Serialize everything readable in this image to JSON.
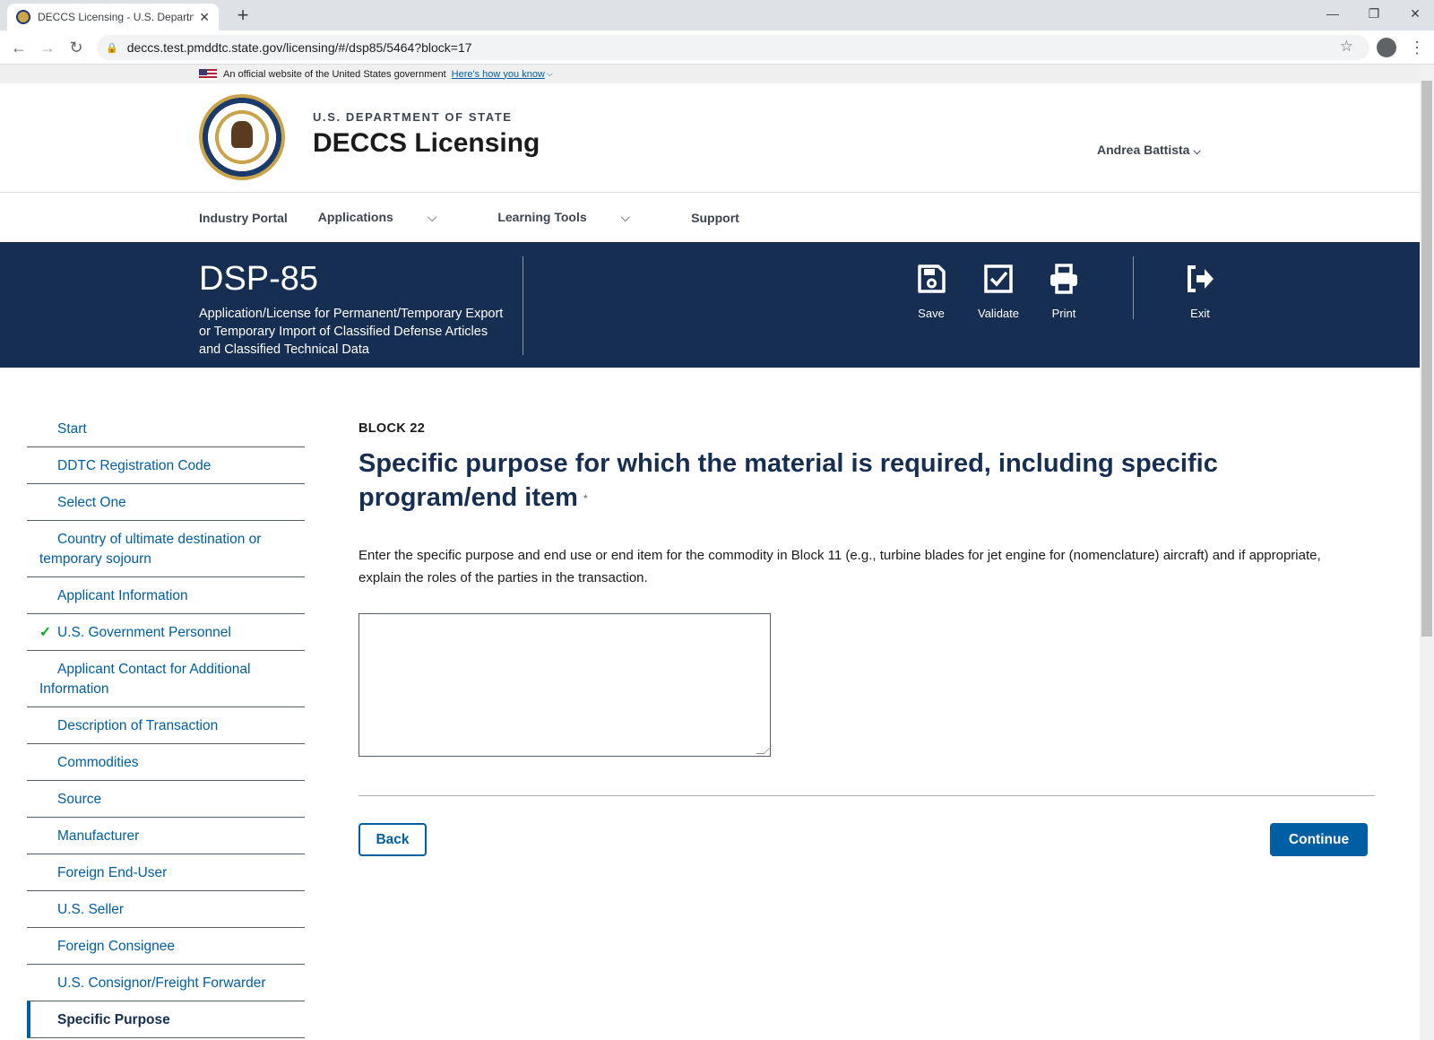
{
  "browser": {
    "tab_title": "DECCS Licensing - U.S. Departme",
    "url": "deccs.test.pmddtc.state.gov/licensing/#/dsp85/5464?block=17"
  },
  "gov_banner": {
    "text": "An official website of the United States government",
    "link": "Here's how you know"
  },
  "header": {
    "dept": "U.S. DEPARTMENT OF STATE",
    "site_title": "DECCS Licensing",
    "user": "Andrea Battista"
  },
  "nav": {
    "items": [
      "Industry Portal",
      "Applications",
      "Learning Tools",
      "Support"
    ]
  },
  "form_banner": {
    "form_number": "DSP-85",
    "description": "Application/License for Permanent/Temporary Export or Temporary Import of Classified Defense Articles and Classified Technical Data",
    "actions": [
      "Save",
      "Validate",
      "Print",
      "Exit"
    ]
  },
  "sidebar": {
    "items": [
      {
        "label": "Start",
        "state": "normal"
      },
      {
        "label": "DDTC Registration Code",
        "state": "normal"
      },
      {
        "label": "Select One",
        "state": "normal"
      },
      {
        "label": "Country of ultimate destination or temporary sojourn",
        "state": "normal"
      },
      {
        "label": "Applicant Information",
        "state": "normal"
      },
      {
        "label": "U.S. Government Personnel",
        "state": "complete"
      },
      {
        "label": "Applicant Contact for Additional Information",
        "state": "normal"
      },
      {
        "label": "Description of Transaction",
        "state": "normal"
      },
      {
        "label": "Commodities",
        "state": "normal"
      },
      {
        "label": "Source",
        "state": "normal"
      },
      {
        "label": "Manufacturer",
        "state": "normal"
      },
      {
        "label": "Foreign End-User",
        "state": "normal"
      },
      {
        "label": "U.S. Seller",
        "state": "normal"
      },
      {
        "label": "Foreign Consignee",
        "state": "normal"
      },
      {
        "label": "U.S. Consignor/Freight Forwarder",
        "state": "normal"
      },
      {
        "label": "Specific Purpose",
        "state": "active"
      }
    ]
  },
  "main": {
    "block": "BLOCK 22",
    "question": "Specific purpose for which the material is required, including specific program/end item",
    "required_mark": "*",
    "help": "Enter the specific purpose and end use or end item for the commodity in Block 11 (e.g., turbine blades for jet engine for (nomenclature) aircraft) and if appropriate, explain the roles of the parties in the transaction.",
    "textarea_value": "",
    "back_label": "Back",
    "continue_label": "Continue"
  },
  "colors": {
    "banner": "#162e51",
    "link": "#005ea2",
    "complete_check": "#00a91c"
  }
}
